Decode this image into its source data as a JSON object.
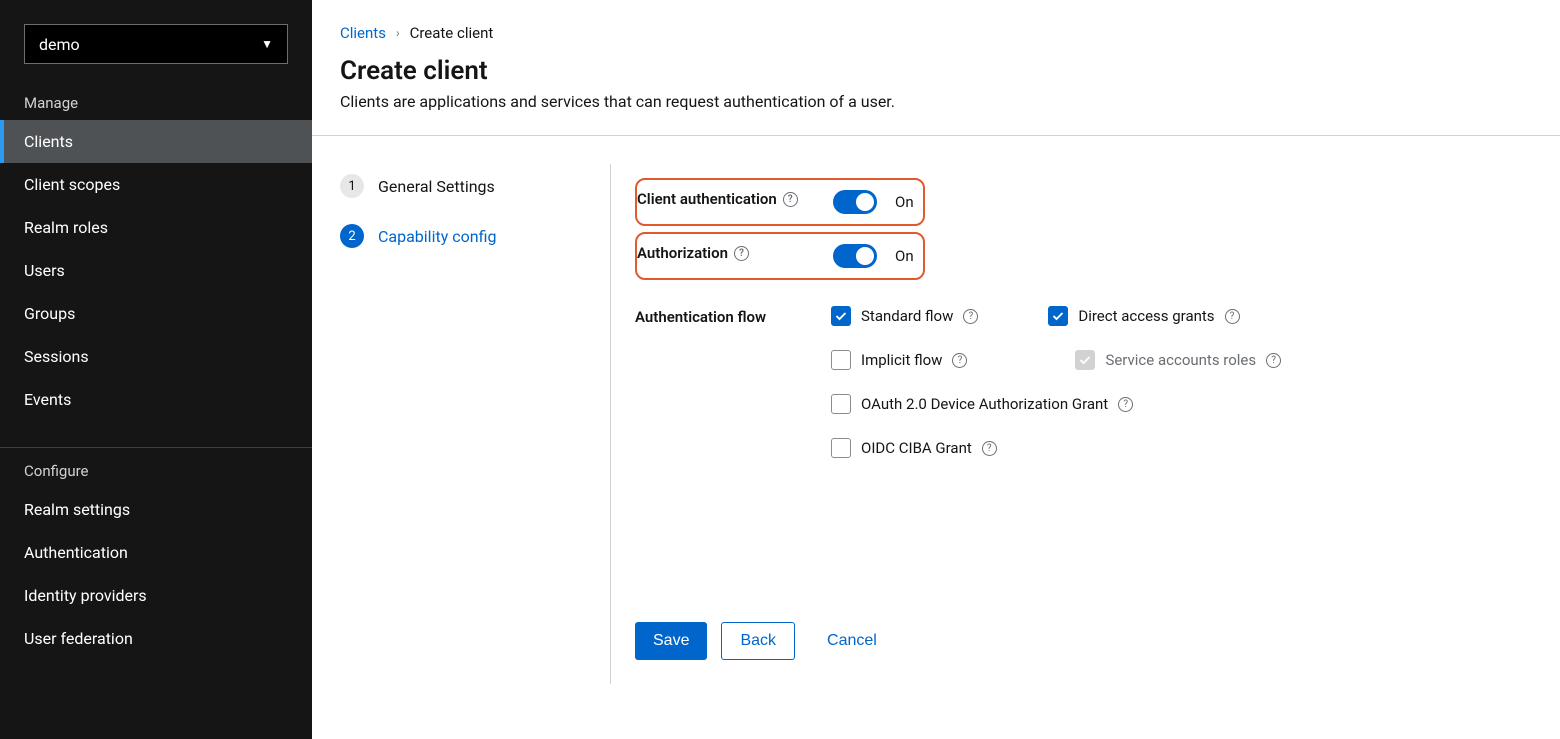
{
  "realm_selector": {
    "value": "demo"
  },
  "sidebar": {
    "section_manage": "Manage",
    "section_configure": "Configure",
    "items_manage": [
      {
        "label": "Clients",
        "active": true
      },
      {
        "label": "Client scopes"
      },
      {
        "label": "Realm roles"
      },
      {
        "label": "Users"
      },
      {
        "label": "Groups"
      },
      {
        "label": "Sessions"
      },
      {
        "label": "Events"
      }
    ],
    "items_configure": [
      {
        "label": "Realm settings"
      },
      {
        "label": "Authentication"
      },
      {
        "label": "Identity providers"
      },
      {
        "label": "User federation"
      }
    ]
  },
  "breadcrumb": {
    "root": "Clients",
    "current": "Create client"
  },
  "page": {
    "title": "Create client",
    "subtitle": "Clients are applications and services that can request authentication of a user."
  },
  "wizard": {
    "steps": [
      {
        "num": "1",
        "label": "General Settings",
        "state": "done"
      },
      {
        "num": "2",
        "label": "Capability config",
        "state": "current"
      }
    ]
  },
  "form": {
    "client_auth": {
      "label": "Client authentication",
      "state": "On"
    },
    "authorization": {
      "label": "Authorization",
      "state": "On"
    },
    "auth_flow_label": "Authentication flow",
    "flows": {
      "standard": "Standard flow",
      "direct": "Direct access grants",
      "implicit": "Implicit flow",
      "service": "Service accounts roles",
      "device": "OAuth 2.0 Device Authorization Grant",
      "ciba": "OIDC CIBA Grant"
    }
  },
  "buttons": {
    "save": "Save",
    "back": "Back",
    "cancel": "Cancel"
  }
}
